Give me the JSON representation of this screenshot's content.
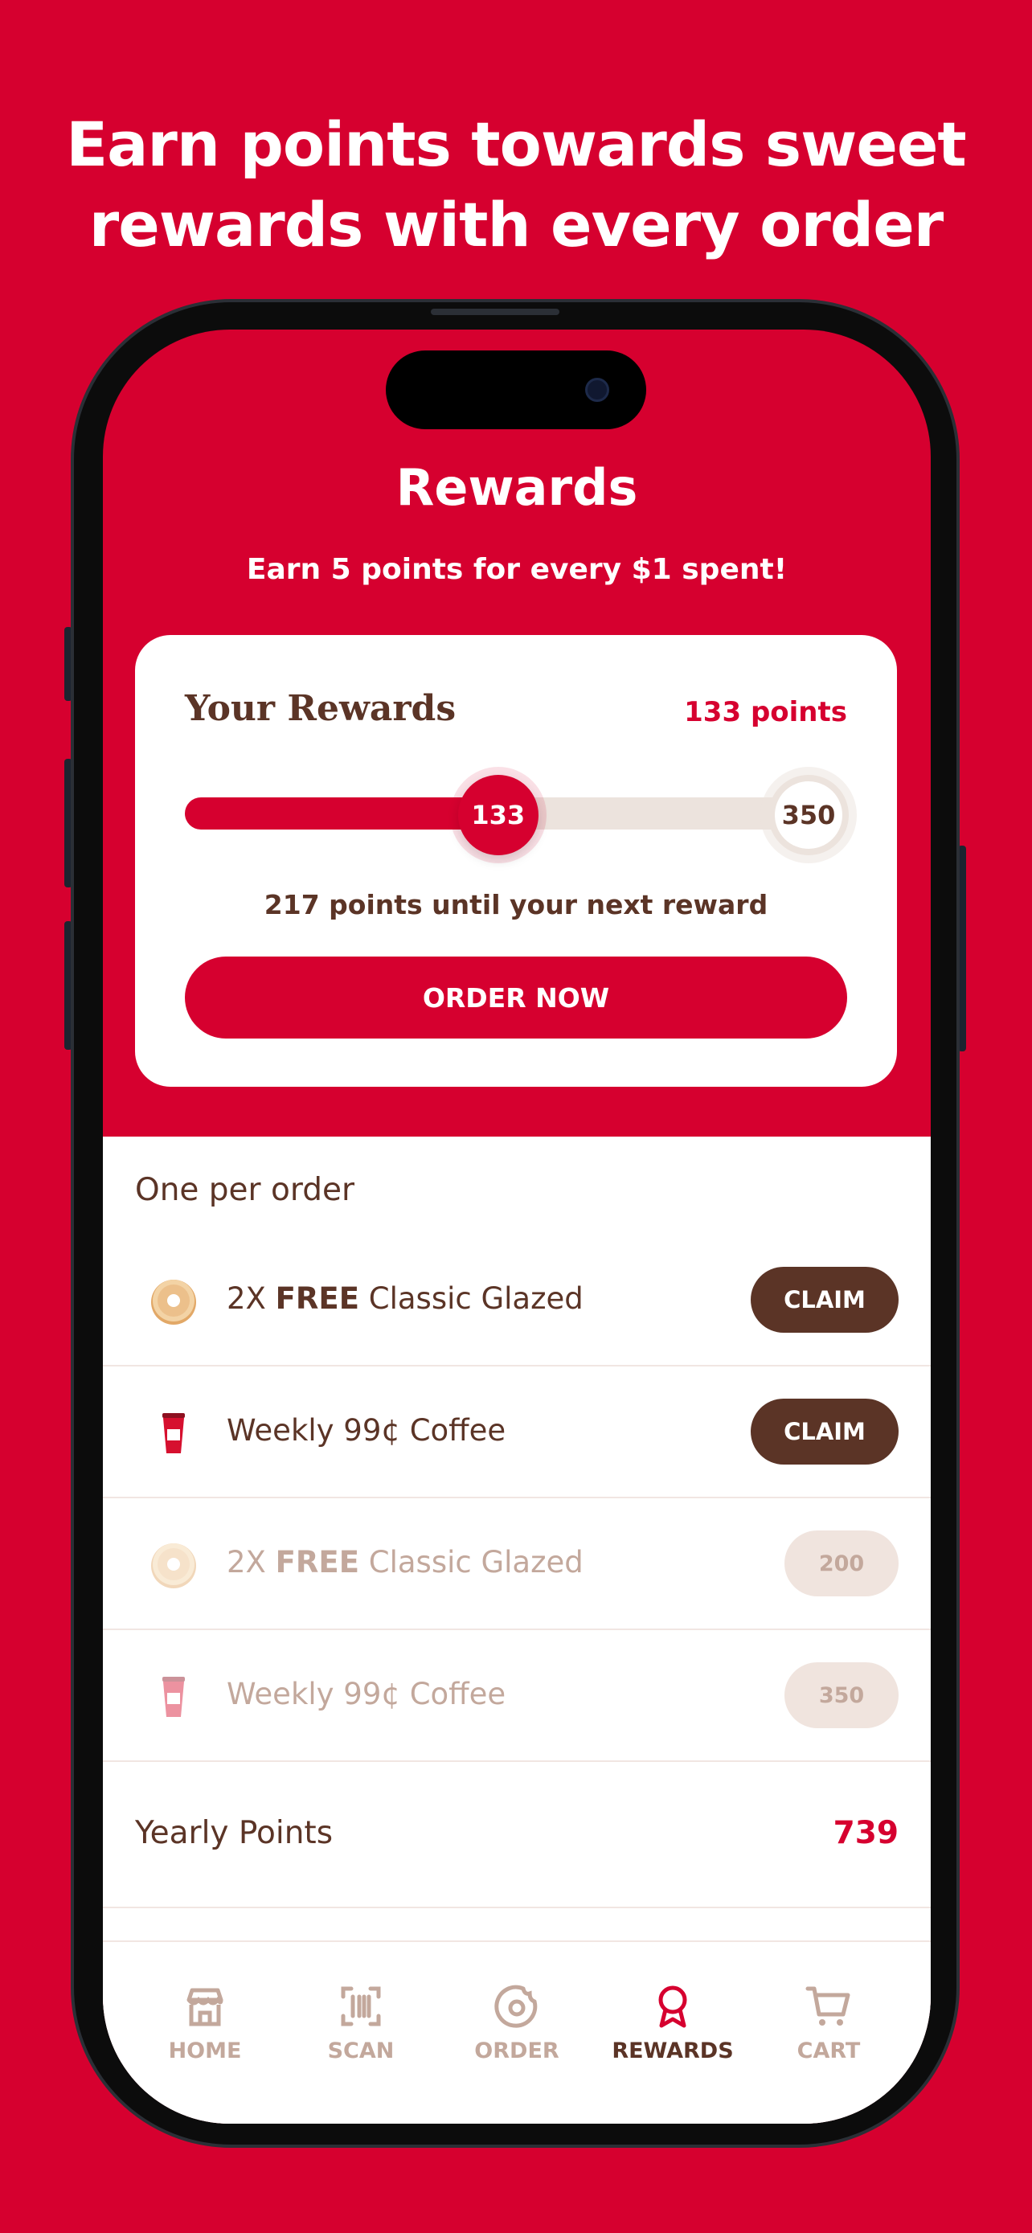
{
  "headline": {
    "line1": "Earn points towards sweet",
    "line2": "rewards with every order"
  },
  "colors": {
    "brand_red": "#d6002f",
    "brown": "#5b3426",
    "muted": "#c3a89c",
    "track": "#ece3dd"
  },
  "screen": {
    "title": "Rewards",
    "subtitle": "Earn 5 points for every $1 spent!"
  },
  "rewards_card": {
    "title": "Your Rewards",
    "points_label": "133 points",
    "current_points": 133,
    "goal_points": 350,
    "current_label": "133",
    "goal_label": "350",
    "until_text": "217 points until your next reward",
    "order_button": "ORDER NOW"
  },
  "list": {
    "section_label": "One per order",
    "items": [
      {
        "qty": "2X",
        "free": "FREE",
        "name": "Classic Glazed",
        "icon": "donut-icon",
        "action": "CLAIM",
        "locked": false
      },
      {
        "qty": "",
        "free": "",
        "name": "Weekly 99¢ Coffee",
        "icon": "coffee-cup-icon",
        "action": "CLAIM",
        "locked": false
      },
      {
        "qty": "2X",
        "free": "FREE",
        "name": "Classic Glazed",
        "icon": "donut-icon",
        "action": "200",
        "locked": true
      },
      {
        "qty": "",
        "free": "",
        "name": "Weekly 99¢ Coffee",
        "icon": "coffee-cup-icon",
        "action": "350",
        "locked": true
      }
    ]
  },
  "yearly": {
    "label": "Yearly Points",
    "value": "739"
  },
  "tabbar": {
    "tabs": [
      {
        "label": "HOME",
        "icon": "store-icon"
      },
      {
        "label": "SCAN",
        "icon": "barcode-scan-icon"
      },
      {
        "label": "ORDER",
        "icon": "donut-outline-icon"
      },
      {
        "label": "REWARDS",
        "icon": "award-ribbon-icon",
        "active": true
      },
      {
        "label": "CART",
        "icon": "cart-icon"
      }
    ]
  }
}
